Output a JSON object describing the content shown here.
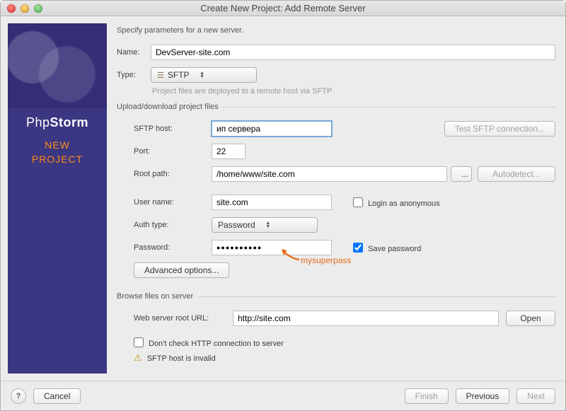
{
  "window": {
    "title": "Create New Project: Add Remote Server"
  },
  "sidebar": {
    "brand_thin": "Php",
    "brand_bold": "Storm",
    "line1": "NEW",
    "line2": "PROJECT"
  },
  "intro": "Specify parameters for a new server.",
  "labels": {
    "name": "Name:",
    "type": "Type:",
    "hint": "Project files are deployed to a remote host via SFTP",
    "fs_updown": "Upload/download project files",
    "sftp_host": "SFTP host:",
    "port": "Port:",
    "root_path": "Root path:",
    "user_name": "User name:",
    "auth_type": "Auth type:",
    "password": "Password:",
    "fs_browse": "Browse files on server",
    "web_root": "Web server root URL:",
    "login_anon": "Login as anonymous",
    "save_pw": "Save password",
    "dont_check": "Don't check HTTP connection to server",
    "warn": "SFTP host is invalid"
  },
  "values": {
    "name": "DevServer-site.com",
    "type": "SFTP",
    "sftp_host": "ип сервера",
    "port": "22",
    "root_path": "/home/www/site.com",
    "user_name": "site.com",
    "auth_type": "Password",
    "password": "●●●●●●●●●●",
    "web_root": "http://site.com",
    "save_pw_checked": true
  },
  "buttons": {
    "test": "Test SFTP connection...",
    "browse": "...",
    "autodetect": "Autodetect...",
    "advanced": "Advanced options...",
    "open": "Open",
    "help": "?",
    "cancel": "Cancel",
    "finish": "Finish",
    "previous": "Previous",
    "next": "Next"
  },
  "annotation": {
    "text": "mysuperpass"
  }
}
